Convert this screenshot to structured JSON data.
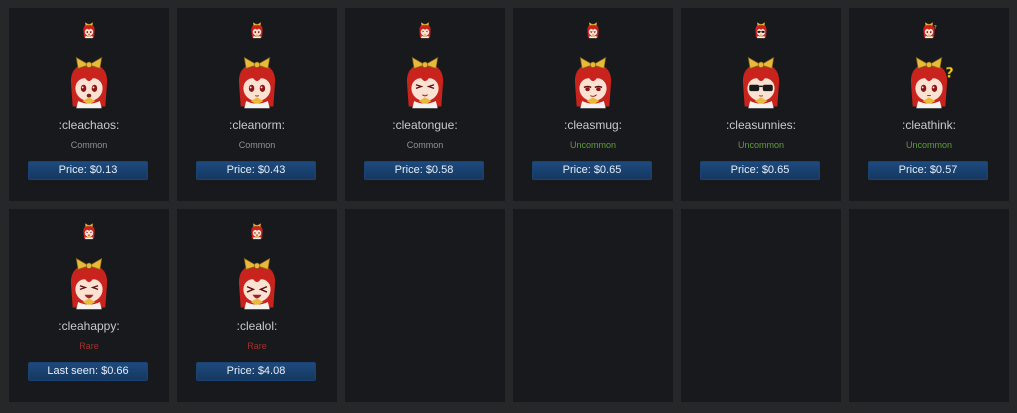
{
  "colors": {
    "page_bg": "#262729",
    "cell_bg": "#18191d",
    "name_text": "#c8c9cb",
    "button_bg": "#1d4a7d",
    "button_text": "#e7eef7",
    "rarity_common": "#8f9193",
    "rarity_uncommon": "#5f9c3c",
    "rarity_rare": "#a62d2a",
    "hair_red": "#c8231d",
    "bow_gold": "#e9b93a"
  },
  "emotes": [
    {
      "name": ":cleachaos:",
      "rarity": "Common",
      "rarity_color": "#8f9193",
      "price": "Price: $0.13",
      "face": "chaos",
      "icon": "cleachaos-emote-icon"
    },
    {
      "name": ":cleanorm:",
      "rarity": "Common",
      "rarity_color": "#8f9193",
      "price": "Price: $0.43",
      "face": "norm",
      "icon": "cleanorm-emote-icon"
    },
    {
      "name": ":cleatongue:",
      "rarity": "Common",
      "rarity_color": "#8f9193",
      "price": "Price: $0.58",
      "face": "tongue",
      "icon": "cleatongue-emote-icon"
    },
    {
      "name": ":cleasmug:",
      "rarity": "Uncommon",
      "rarity_color": "#5f9c3c",
      "price": "Price: $0.65",
      "face": "smug",
      "icon": "cleasmug-emote-icon"
    },
    {
      "name": ":cleasunnies:",
      "rarity": "Uncommon",
      "rarity_color": "#5f9c3c",
      "price": "Price: $0.65",
      "face": "sunnies",
      "icon": "cleasunnies-emote-icon"
    },
    {
      "name": ":cleathink:",
      "rarity": "Uncommon",
      "rarity_color": "#5f9c3c",
      "price": "Price: $0.57",
      "face": "think",
      "icon": "cleathink-emote-icon"
    },
    {
      "name": ":cleahappy:",
      "rarity": "Rare",
      "rarity_color": "#a62d2a",
      "price": "Last seen: $0.66",
      "face": "happy",
      "icon": "cleahappy-emote-icon"
    },
    {
      "name": ":clealol:",
      "rarity": "Rare",
      "rarity_color": "#a62d2a",
      "price": "Price: $4.08",
      "face": "lol",
      "icon": "clealol-emote-icon"
    }
  ],
  "empty_slot_count": 4
}
